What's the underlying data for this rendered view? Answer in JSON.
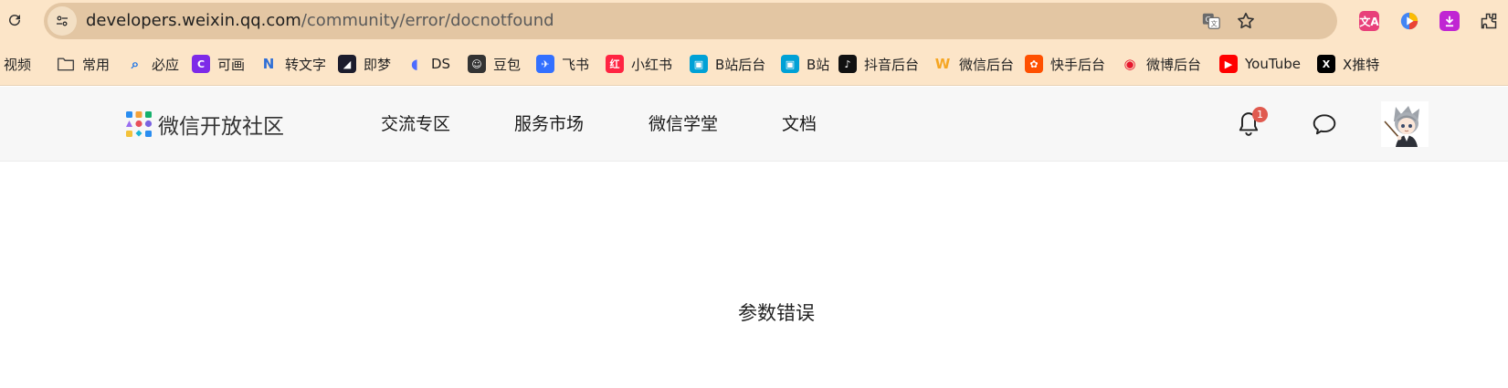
{
  "browser": {
    "url_host": "developers.weixin.qq.com",
    "url_path": "/community/error/docnotfound",
    "toolbar_icons": [
      "reload-icon",
      "site-info-icon",
      "translate-icon",
      "bookmark-star-icon",
      "extension-icon"
    ],
    "bookmarks": [
      {
        "label": "视频",
        "icon": "bookmark-icon"
      },
      {
        "label": "常用",
        "icon": "folder-icon"
      },
      {
        "label": "必应",
        "icon": "search-icon",
        "color": "#1a73e8"
      },
      {
        "label": "可画",
        "icon": "canva-icon",
        "color": "#7d2ae8"
      },
      {
        "label": "转文字",
        "icon": "n-icon",
        "color": "#2f6fd6"
      },
      {
        "label": "即梦",
        "icon": "jimeng-icon",
        "color": "#1c1c2c"
      },
      {
        "label": "DS",
        "icon": "deepseek-icon",
        "color": "#4d6bfe"
      },
      {
        "label": "豆包",
        "icon": "doubao-icon",
        "color": "#333333"
      },
      {
        "label": "飞书",
        "icon": "feishu-icon",
        "color": "#3370ff"
      },
      {
        "label": "小红书",
        "icon": "xiaohongshu-icon",
        "color": "#ff2442"
      },
      {
        "label": "B站后台",
        "icon": "bilibili-icon",
        "color": "#00a1d6"
      },
      {
        "label": "B站",
        "icon": "bilibili-icon",
        "color": "#00a1d6"
      },
      {
        "label": "抖音后台",
        "icon": "douyin-icon",
        "color": "#111111"
      },
      {
        "label": "微信后台",
        "icon": "wechat-w-icon",
        "color": "#f5a623"
      },
      {
        "label": "快手后台",
        "icon": "kuaishou-icon",
        "color": "#ff5000"
      },
      {
        "label": "微博后台",
        "icon": "weibo-icon",
        "color": "#e6162d"
      },
      {
        "label": "YouTube",
        "icon": "youtube-icon",
        "color": "#ff0000"
      },
      {
        "label": "X推特",
        "icon": "x-icon",
        "color": "#000000"
      }
    ]
  },
  "site": {
    "logo_text": "微信开放社区",
    "nav": [
      "交流专区",
      "服务市场",
      "微信学堂",
      "文档"
    ],
    "notification_count": "1"
  },
  "main": {
    "message": "参数错误"
  }
}
